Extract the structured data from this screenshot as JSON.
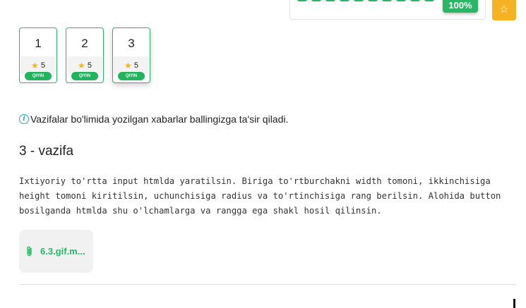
{
  "progress": {
    "percent_label": "100%",
    "segments_filled": 10,
    "accent": "#2bb665"
  },
  "favorite_icon": "star-icon",
  "tasks": [
    {
      "number": "1",
      "score": "5",
      "difficulty": "QIYIN"
    },
    {
      "number": "2",
      "score": "5",
      "difficulty": "QIYIN"
    },
    {
      "number": "3",
      "score": "5",
      "difficulty": "QIYIN"
    }
  ],
  "info_text": "Vazifalar bo'limida yozilgan xabarlar ballingizga ta'sir qiladi.",
  "task": {
    "title": "3 - vazifa",
    "description": "Ixtiyoriy to'rtta input htmlda yaratilsin. Biriga to'rtburchakni width tomoni, ikkinchisiga height tomoni kiritilsin, uchunchisiga radius va to'rtinchisiga rang berilsin. Alohida button bosilganda htmlda shu o'lchamlarga va rangga ega shakl hosil qilinsin.",
    "attachment": "6.3.gif.m..."
  }
}
